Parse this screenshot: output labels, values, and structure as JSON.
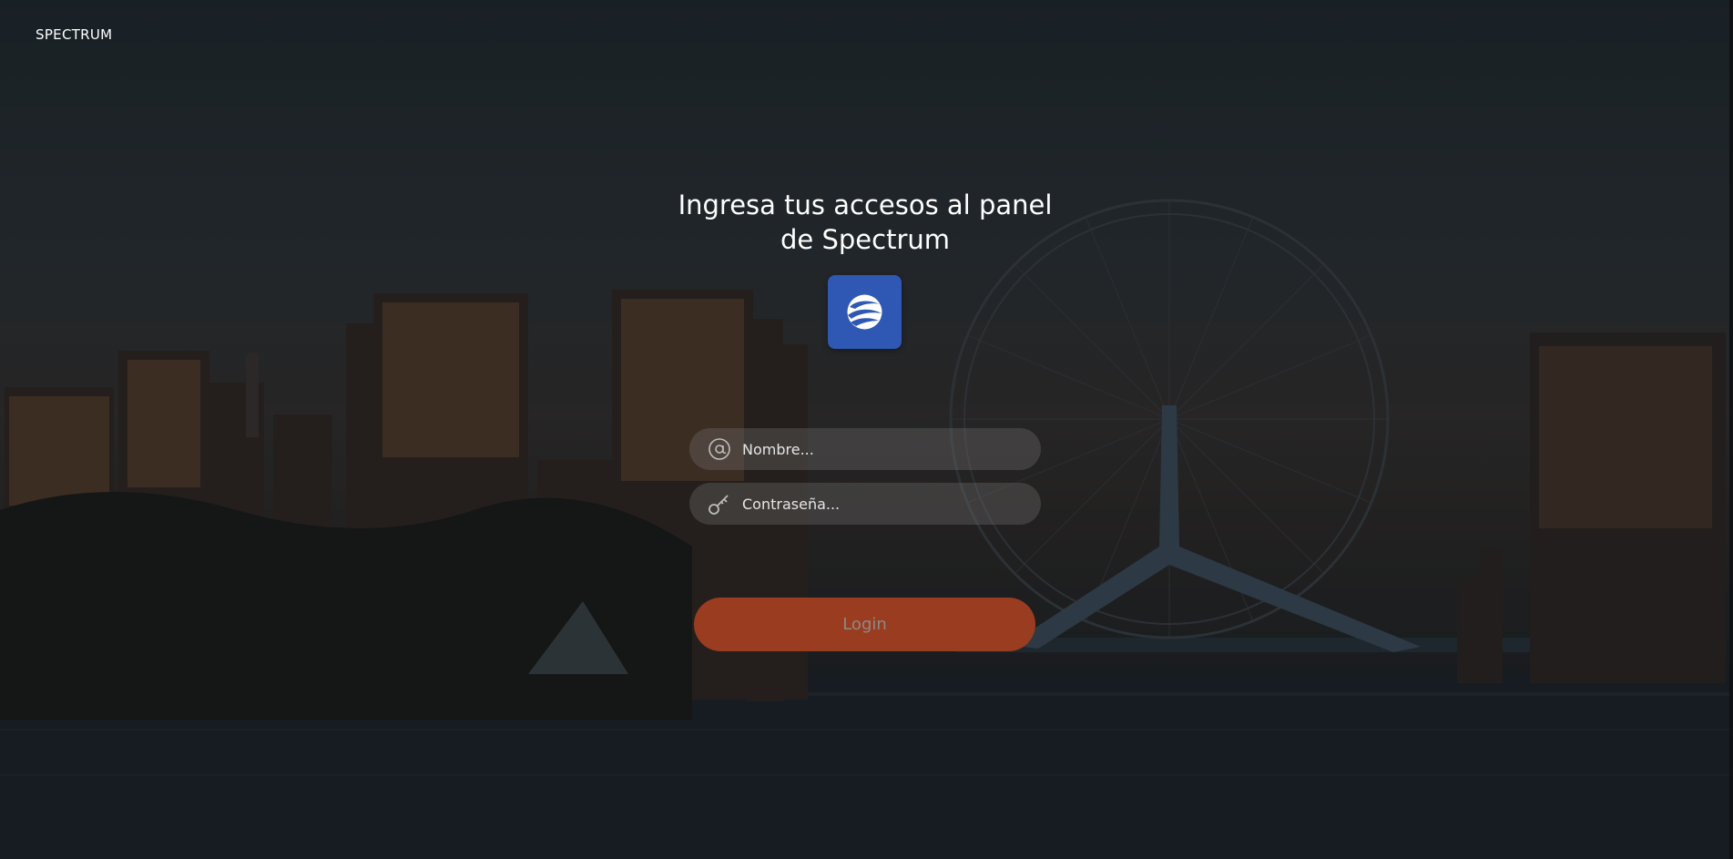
{
  "brand": {
    "name": "SPECTRUM"
  },
  "heading": {
    "line1": "Ingresa tus accesos al panel",
    "line2": "de Spectrum"
  },
  "logo": {
    "icon": "spectrum-logo-icon",
    "background": "#2f58b4"
  },
  "form": {
    "username": {
      "placeholder": "Nombre...",
      "value": "",
      "icon": "at-sign-icon"
    },
    "password": {
      "placeholder": "Contraseña...",
      "value": "",
      "icon": "key-icon"
    },
    "submit_label": "Login"
  },
  "colors": {
    "accent": "#9a3c1f",
    "field_bg": "#5a5756",
    "text": "#ffffff"
  }
}
